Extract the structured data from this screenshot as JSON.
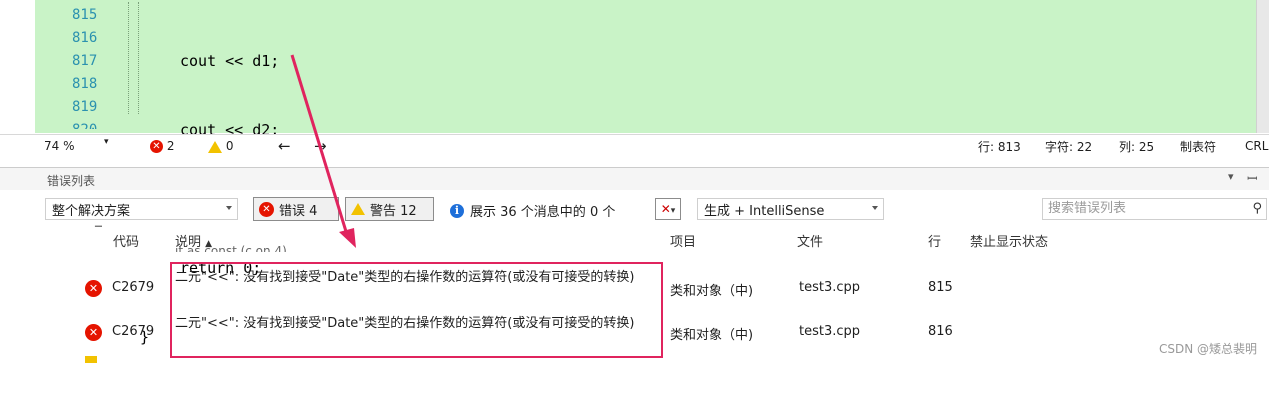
{
  "editor": {
    "line_numbers": [
      "815",
      "816",
      "817",
      "818",
      "819",
      "820"
    ],
    "lines": [
      {
        "text": "cout << d1;"
      },
      {
        "text": "cout << d2;"
      },
      {
        "text": ""
      },
      {
        "text": "return 0;"
      },
      {
        "text": "}"
      }
    ]
  },
  "status_bar": {
    "zoom": "74 %",
    "errors": "2",
    "warnings": "0",
    "line": "行: 813",
    "char": "字符: 22",
    "col": "列: 25",
    "tabs": "制表符",
    "eol": "CRL"
  },
  "error_list": {
    "title": "错误列表",
    "scope": "整个解决方案",
    "errors_button": "错误 4",
    "warnings_button": "警告 12",
    "messages_button": "展示 36 个消息中的 0 个",
    "build_filter": "生成 + IntelliSense",
    "search_placeholder": "搜索错误列表",
    "columns": {
      "code": "代码",
      "description": "说明",
      "project": "项目",
      "file": "文件",
      "line": "行",
      "suppression": "禁止显示状态"
    },
    "partial_row_text": "it as const (c on.4).",
    "rows": [
      {
        "code": "C2679",
        "description": "二元\"<<\": 没有找到接受\"Date\"类型的右操作数的运算符(或没有可接受的转换)",
        "project": "类和对象（中)",
        "file": "test3.cpp",
        "line": "815"
      },
      {
        "code": "C2679",
        "description": "二元\"<<\": 没有找到接受\"Date\"类型的右操作数的运算符(或没有可接受的转换)",
        "project": "类和对象（中)",
        "file": "test3.cpp",
        "line": "816"
      }
    ]
  },
  "watermark": "CSDN @矮总裴明",
  "colors": {
    "editor_bg": "#c9f3c7",
    "error_red": "#e51400",
    "annotation": "#e0245e"
  }
}
